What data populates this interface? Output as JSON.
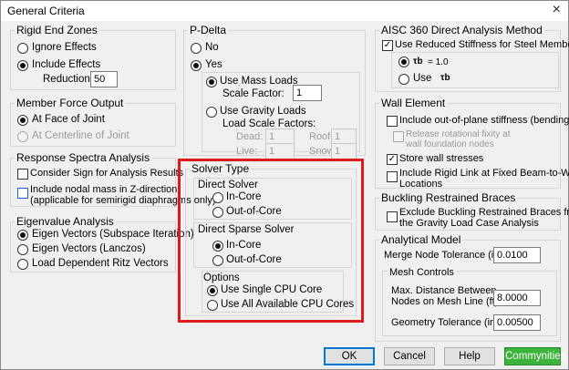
{
  "window": {
    "title": "General Criteria",
    "close_glyph": "×"
  },
  "rigid_end": {
    "title": "Rigid End Zones",
    "ignore_label": "Ignore Effects",
    "include_label": "Include Effects",
    "reduction_label": "Reduction %:",
    "reduction_value": "50"
  },
  "member_force": {
    "title": "Member Force Output",
    "face_label": "At Face of Joint",
    "centerline_label": "At Centerline of Joint"
  },
  "response_spectra": {
    "title": "Response Spectra Analysis",
    "consider_sign_label": "Consider Sign for Analysis Results",
    "nodal_mass_line1": "Include nodal mass in Z-direction",
    "nodal_mass_line2": "(applicable for semirigid diaphragms only)"
  },
  "eigenvalue": {
    "title": "Eigenvalue Analysis",
    "subspace_label": "Eigen Vectors (Subspace Iteration)",
    "lanczos_label": "Eigen Vectors (Lanczos)",
    "ritz_label": "Load Dependent Ritz Vectors"
  },
  "pdelta": {
    "title": "P-Delta",
    "no_label": "No",
    "yes_label": "Yes",
    "mass_loads_label": "Use Mass Loads",
    "scale_factor_label": "Scale Factor:",
    "scale_factor_value": "1",
    "gravity_loads_label": "Use Gravity Loads",
    "load_scale_label": "Load Scale Factors:",
    "dead_label": "Dead:",
    "dead_value": "1",
    "roof_label": "Roof:",
    "roof_value": "1",
    "live_label": "Live:",
    "live_value": "1",
    "snow_label": "Snow:",
    "snow_value": "1"
  },
  "solver": {
    "title": "Solver Type",
    "direct_title": "Direct Solver",
    "direct_incore": "In-Core",
    "direct_outcore": "Out-of-Core",
    "sparse_title": "Direct Sparse Solver",
    "sparse_incore": "In-Core",
    "sparse_outcore": "Out-of-Core",
    "options_title": "Options",
    "single_cpu": "Use Single CPU Core",
    "all_cpu": "Use All Available CPU Cores",
    "highlight_color": "#e0191b"
  },
  "aisc": {
    "title": "AISC 360 Direct Analysis Method",
    "reduced_label": "Use Reduced Stiffness for Steel Members",
    "tau_glyph": "τb",
    "tau_eq": "= 1.0",
    "use_label": "Use"
  },
  "wall": {
    "title": "Wall Element",
    "out_of_plane": "Include out-of-plane stiffness (bending)",
    "release_line1": "Release rotational fixity at",
    "release_line2": "wall foundation nodes",
    "store_stress": "Store wall stresses",
    "rigid_link_line1": "Include Rigid Link at Fixed Beam-to-Wall",
    "rigid_link_line2": "Locations"
  },
  "buckling": {
    "title": "Buckling Restrained Braces",
    "exclude_line1": "Exclude Buckling Restrained Braces from",
    "exclude_line2": "the Gravity Load Case Analysis"
  },
  "analytical": {
    "title": "Analytical Model",
    "merge_label": "Merge Node Tolerance (in):",
    "merge_value": "0.0100",
    "mesh_title": "Mesh Controls",
    "max_dist_line1": "Max. Distance Between",
    "max_dist_line2": "Nodes on Mesh Line (ft):",
    "max_dist_value": "8.0000",
    "geom_label": "Geometry Tolerance (in) :",
    "geom_value": "0.00500"
  },
  "buttons": {
    "ok": "OK",
    "cancel": "Cancel",
    "help": "Help",
    "commynities": "Commynities..."
  }
}
